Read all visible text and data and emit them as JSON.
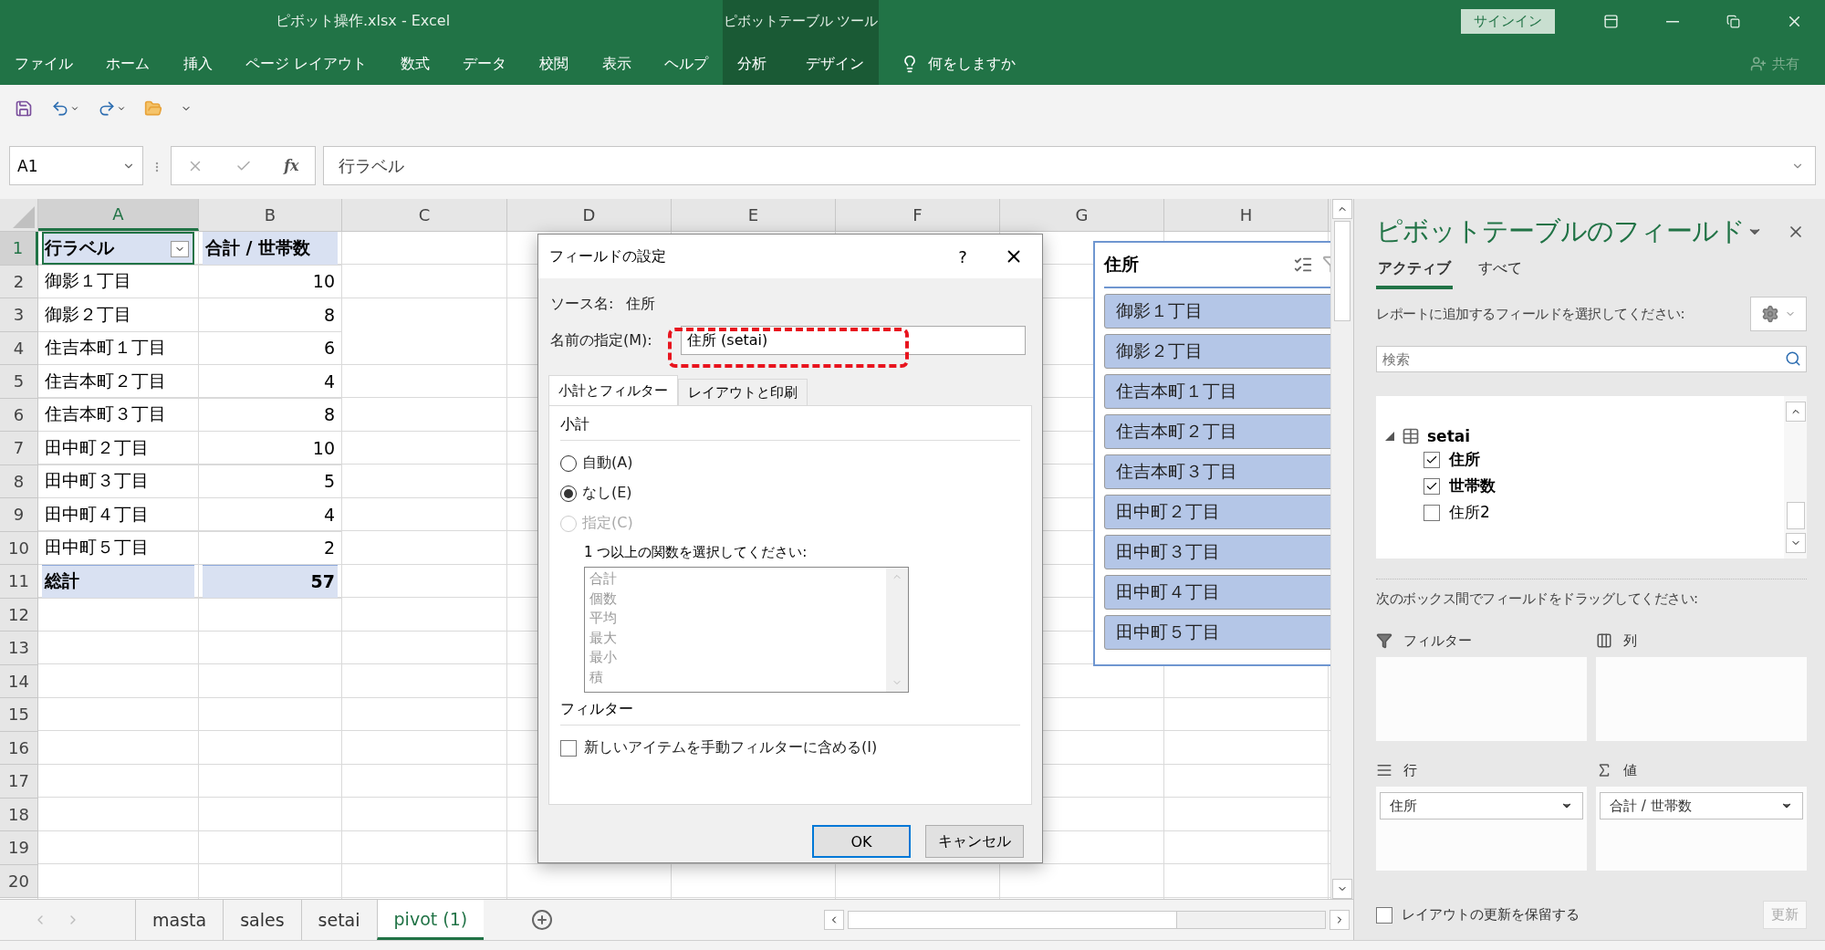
{
  "window": {
    "title": "ピボット操作.xlsx  -  Excel",
    "context_title": "ピボットテーブル ツール",
    "sign_in": "サインイン"
  },
  "ribbon_tabs": [
    {
      "label": "ファイル",
      "contextual": false
    },
    {
      "label": "ホーム",
      "contextual": false
    },
    {
      "label": "挿入",
      "contextual": false
    },
    {
      "label": "ページ レイアウト",
      "contextual": false
    },
    {
      "label": "数式",
      "contextual": false
    },
    {
      "label": "データ",
      "contextual": false
    },
    {
      "label": "校閲",
      "contextual": false
    },
    {
      "label": "表示",
      "contextual": false
    },
    {
      "label": "ヘルプ",
      "contextual": false
    },
    {
      "label": "分析",
      "contextual": true
    },
    {
      "label": "デザイン",
      "contextual": true
    }
  ],
  "tell_me": "何をしますか",
  "share": "共有",
  "name_box": "A1",
  "insert_function": "fx",
  "formula": "行ラベル",
  "columns": [
    {
      "label": "A",
      "selected": true
    },
    {
      "label": "B",
      "selected": false
    },
    {
      "label": "C",
      "selected": false
    },
    {
      "label": "D",
      "selected": false
    },
    {
      "label": "E",
      "selected": false
    },
    {
      "label": "F",
      "selected": false
    },
    {
      "label": "G",
      "selected": false
    },
    {
      "label": "H",
      "selected": false
    }
  ],
  "row_numbers": [
    {
      "label": "1",
      "selected": true
    },
    {
      "label": "2",
      "selected": false
    },
    {
      "label": "3",
      "selected": false
    },
    {
      "label": "4",
      "selected": false
    },
    {
      "label": "5",
      "selected": false
    },
    {
      "label": "6",
      "selected": false
    },
    {
      "label": "7",
      "selected": false
    },
    {
      "label": "8",
      "selected": false
    },
    {
      "label": "9",
      "selected": false
    },
    {
      "label": "10",
      "selected": false
    },
    {
      "label": "11",
      "selected": false
    },
    {
      "label": "12",
      "selected": false
    },
    {
      "label": "13",
      "selected": false
    },
    {
      "label": "14",
      "selected": false
    },
    {
      "label": "15",
      "selected": false
    },
    {
      "label": "16",
      "selected": false
    },
    {
      "label": "17",
      "selected": false
    },
    {
      "label": "18",
      "selected": false
    },
    {
      "label": "19",
      "selected": false
    },
    {
      "label": "20",
      "selected": false
    }
  ],
  "pivot_table": [
    {
      "kind": "header",
      "label": "行ラベル",
      "value": "合計 / 世帯数"
    },
    {
      "kind": "item",
      "label": "御影１丁目",
      "value": "10"
    },
    {
      "kind": "item",
      "label": "御影２丁目",
      "value": "8"
    },
    {
      "kind": "item",
      "label": "住吉本町１丁目",
      "value": "6"
    },
    {
      "kind": "item",
      "label": "住吉本町２丁目",
      "value": "4"
    },
    {
      "kind": "item",
      "label": "住吉本町３丁目",
      "value": "8"
    },
    {
      "kind": "item",
      "label": "田中町２丁目",
      "value": "10"
    },
    {
      "kind": "item",
      "label": "田中町３丁目",
      "value": "5"
    },
    {
      "kind": "item",
      "label": "田中町４丁目",
      "value": "4"
    },
    {
      "kind": "item",
      "label": "田中町５丁目",
      "value": "2"
    },
    {
      "kind": "total",
      "label": "総計",
      "value": "57"
    }
  ],
  "slicer": {
    "title": "住所",
    "items": [
      "御影１丁目",
      "御影２丁目",
      "住吉本町１丁目",
      "住吉本町２丁目",
      "住吉本町３丁目",
      "田中町２丁目",
      "田中町３丁目",
      "田中町４丁目",
      "田中町５丁目"
    ]
  },
  "dialog": {
    "title": "フィールドの設定",
    "help": "?",
    "source_label": "ソース名:",
    "source_value": "住所",
    "name_label": "名前の指定(M):",
    "name_value": "住所 (setai)",
    "tabs": [
      {
        "label": "小計とフィルター",
        "selected": true
      },
      {
        "label": "レイアウトと印刷",
        "selected": false
      }
    ],
    "subtotal_heading": "小計",
    "radios": [
      {
        "label": "自動(A)",
        "selected": false,
        "disabled": false
      },
      {
        "label": "なし(E)",
        "selected": true,
        "disabled": false
      },
      {
        "label": "指定(C)",
        "selected": false,
        "disabled": true
      }
    ],
    "function_prompt": "1 つ以上の関数を選択してください:",
    "functions": {
      "disabled": true,
      "items": [
        "合計",
        "個数",
        "平均",
        "最大",
        "最小",
        "積"
      ]
    },
    "filter_heading": "フィルター",
    "filter_checkbox": {
      "label": "新しいアイテムを手動フィルターに含める(I)",
      "checked": false
    },
    "buttons": [
      {
        "label": "OK",
        "default": true
      },
      {
        "label": "キャンセル",
        "default": false
      }
    ]
  },
  "field_pane": {
    "title": "ピボットテーブルのフィールド",
    "tabs": [
      {
        "label": "アクティブ",
        "selected": true
      },
      {
        "label": "すべて",
        "selected": false
      }
    ],
    "instruction": "レポートに追加するフィールドを選択してください:",
    "search_placeholder": "検索",
    "tree": {
      "label": "setai",
      "expanded": true,
      "children": [
        {
          "label": "住所",
          "checked": true
        },
        {
          "label": "世帯数",
          "checked": true
        },
        {
          "label": "住所2",
          "checked": false
        }
      ]
    },
    "drag_instruction": "次のボックス間でフィールドをドラッグしてください:",
    "areas": [
      {
        "kind": "filter",
        "label": "フィルター"
      },
      {
        "kind": "columns",
        "label": "列"
      },
      {
        "kind": "rows",
        "label": "行",
        "items": [
          "住所"
        ]
      },
      {
        "kind": "values",
        "label": "値",
        "items": [
          "合計 / 世帯数"
        ]
      }
    ],
    "defer": {
      "label": "レイアウトの更新を保留する",
      "checked": false
    },
    "update_button": {
      "label": "更新",
      "disabled": true
    }
  },
  "sheet_tabs": [
    {
      "label": "masta",
      "selected": false
    },
    {
      "label": "sales",
      "selected": false
    },
    {
      "label": "setai",
      "selected": false
    },
    {
      "label": "pivot (1)",
      "selected": true
    }
  ]
}
